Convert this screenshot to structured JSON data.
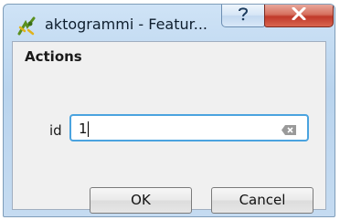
{
  "window": {
    "title": "aktogrammi - Featur...",
    "app_icon": "qgis-logo-icon",
    "help_button_icon": "help-question-icon",
    "close_button_icon": "close-x-icon"
  },
  "group": {
    "title": "Actions"
  },
  "field": {
    "label": "id",
    "value": "1",
    "clear_icon": "clear-input-icon"
  },
  "buttons": {
    "ok_label": "OK",
    "cancel_label": "Cancel"
  },
  "colors": {
    "focus_border": "#4aa3df",
    "close_button": "#c0392b",
    "title_bar": "#b9d4ee"
  }
}
